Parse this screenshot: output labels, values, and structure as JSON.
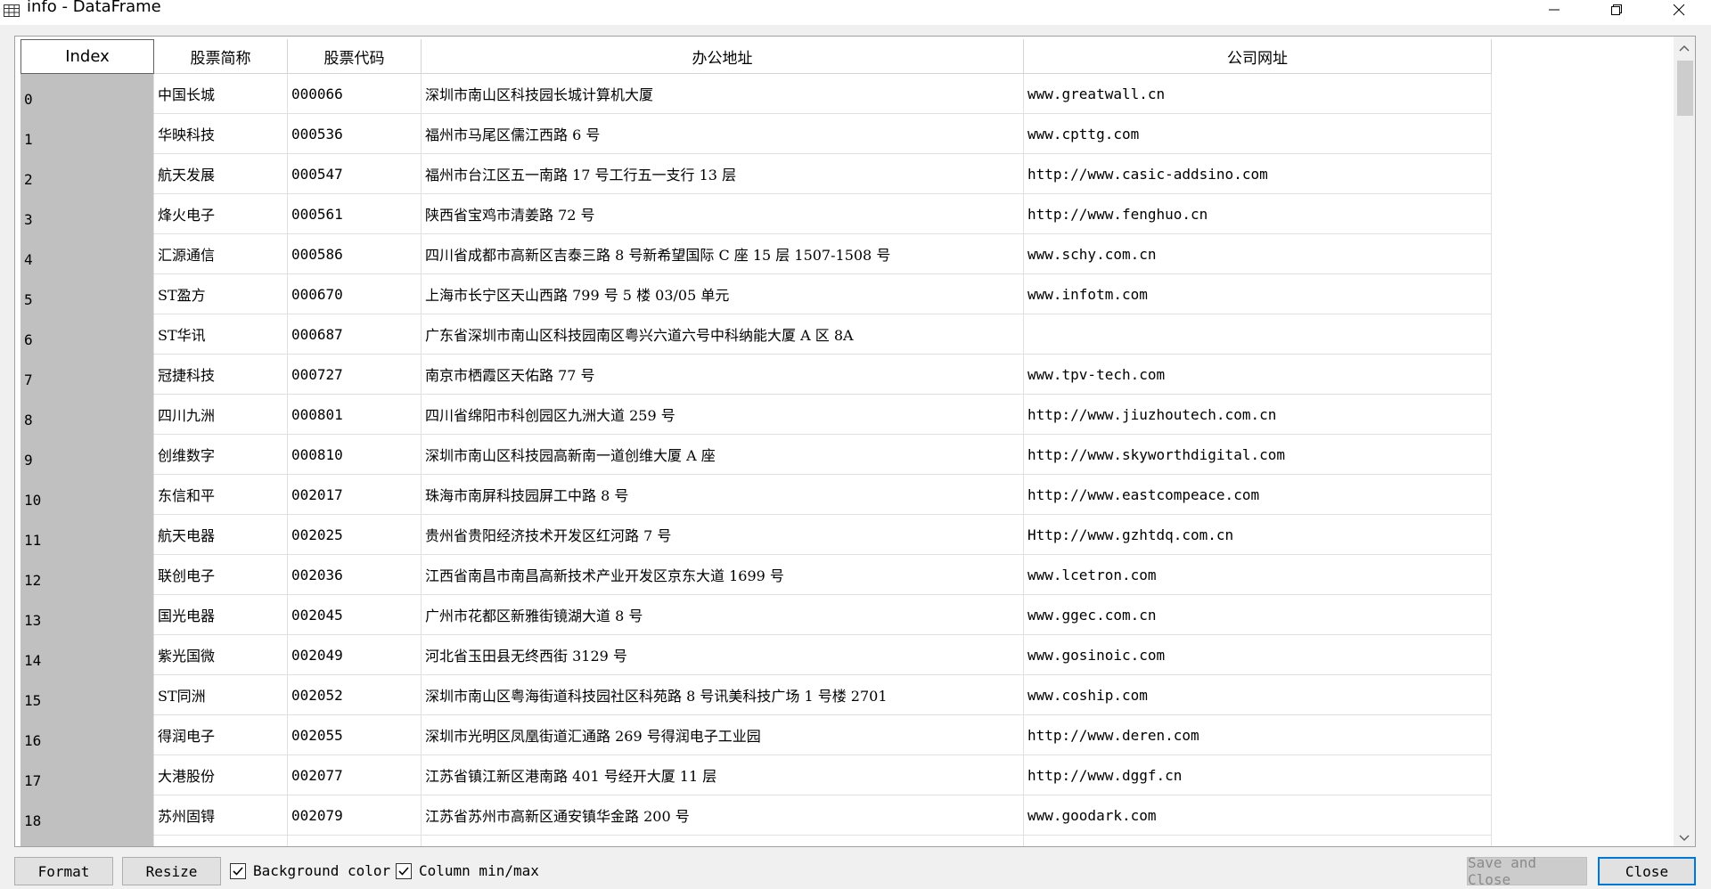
{
  "window": {
    "title": "info - DataFrame",
    "icons": {
      "app": "table-icon",
      "minimize": "minimize-icon",
      "maximize": "restore-icon",
      "close": "close-icon"
    }
  },
  "table": {
    "columns": [
      "Index",
      "股票简称",
      "股票代码",
      "办公地址",
      "公司网址"
    ],
    "rows": [
      [
        "0",
        "中国长城",
        "000066",
        "深圳市南山区科技园长城计算机大厦",
        "www.greatwall.cn"
      ],
      [
        "1",
        "华映科技",
        "000536",
        "福州市马尾区儒江西路 6 号",
        "www.cpttg.com"
      ],
      [
        "2",
        "航天发展",
        "000547",
        "福州市台江区五一南路 17 号工行五一支行 13 层",
        "http://www.casic-addsino.com"
      ],
      [
        "3",
        "烽火电子",
        "000561",
        "陕西省宝鸡市清姜路 72 号",
        "http://www.fenghuo.cn"
      ],
      [
        "4",
        "汇源通信",
        "000586",
        "四川省成都市高新区吉泰三路 8 号新希望国际 C 座 15 层 1507-1508 号",
        "www.schy.com.cn"
      ],
      [
        "5",
        "ST盈方",
        "000670",
        "上海市长宁区天山西路 799 号 5 楼 03/05 单元",
        "www.infotm.com"
      ],
      [
        "6",
        "ST华讯",
        "000687",
        "广东省深圳市南山区科技园南区粤兴六道六号中科纳能大厦 A 区 8A",
        ""
      ],
      [
        "7",
        "冠捷科技",
        "000727",
        "南京市栖霞区天佑路 77 号",
        "www.tpv-tech.com"
      ],
      [
        "8",
        "四川九洲",
        "000801",
        "四川省绵阳市科创园区九洲大道 259 号",
        "http://www.jiuzhoutech.com.cn"
      ],
      [
        "9",
        "创维数字",
        "000810",
        "深圳市南山区科技园高新南一道创维大厦 A 座",
        "http://www.skyworthdigital.com"
      ],
      [
        "10",
        "东信和平",
        "002017",
        "珠海市南屏科技园屏工中路 8 号",
        "http://www.eastcompeace.com"
      ],
      [
        "11",
        "航天电器",
        "002025",
        "贵州省贵阳经济技术开发区红河路 7 号",
        "Http://www.gzhtdq.com.cn"
      ],
      [
        "12",
        "联创电子",
        "002036",
        "江西省南昌市南昌高新技术产业开发区京东大道 1699 号",
        "www.lcetron.com"
      ],
      [
        "13",
        "国光电器",
        "002045",
        "广州市花都区新雅街镜湖大道 8 号",
        "www.ggec.com.cn"
      ],
      [
        "14",
        "紫光国微",
        "002049",
        "河北省玉田县无终西街 3129 号",
        "www.gosinoic.com"
      ],
      [
        "15",
        "ST同洲",
        "002052",
        "深圳市南山区粤海街道科技园社区科苑路 8 号讯美科技广场 1 号楼 2701",
        "www.coship.com"
      ],
      [
        "16",
        "得润电子",
        "002055",
        "深圳市光明区凤凰街道汇通路 269 号得润电子工业园",
        "http://www.deren.com"
      ],
      [
        "17",
        "大港股份",
        "002077",
        "江苏省镇江新区港南路 401 号经开大厦 11 层",
        "http://www.dggf.cn"
      ],
      [
        "18",
        "苏州固锝",
        "002079",
        "江苏省苏州市高新区通安镇华金路 200 号",
        "www.goodark.com"
      ]
    ]
  },
  "toolbar": {
    "format_label": "Format",
    "resize_label": "Resize",
    "background_color_label": "Background color",
    "background_color_checked": true,
    "column_minmax_label": "Column min/max",
    "column_minmax_checked": true,
    "save_close_label": "Save and Close",
    "close_label": "Close"
  },
  "colors": {
    "index_column_bg": "#c0c0c0",
    "accent_border": "#0078d7"
  }
}
